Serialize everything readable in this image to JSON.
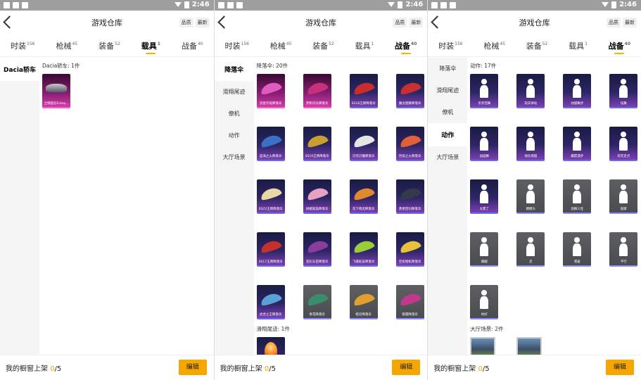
{
  "status": {
    "time": "2:46"
  },
  "header": {
    "title": "游戏仓库",
    "sort_quality": "品质",
    "sort_latest": "最新"
  },
  "tabs": [
    {
      "label": "时装",
      "count": "156"
    },
    {
      "label": "枪械",
      "count": "45"
    },
    {
      "label": "装备",
      "count": "52"
    },
    {
      "label": "载具",
      "count": "1"
    },
    {
      "label": "战备",
      "count": "40"
    }
  ],
  "bottom": {
    "shelf_label": "我的橱窗上架",
    "shelf_current": "0",
    "shelf_total": "/5",
    "edit_label": "编辑"
  },
  "screen1": {
    "active_tab": 3,
    "sidebar": [
      "Dacia轿车"
    ],
    "section_title": "Dacia轿车: 1件",
    "items": [
      {
        "name": "兰博基尼Estoq..."
      }
    ]
  },
  "screen2": {
    "active_tab": 4,
    "sidebar": [
      "降落伞",
      "滑翔尾迹",
      "僚机",
      "动作",
      "大厅场景"
    ],
    "section_title": "降落伞: 20件",
    "items": [
      {
        "name": "流星玲珑降落伞"
      },
      {
        "name": "梦影闪光降落伞"
      },
      {
        "name": "SS18王牌降落伞"
      },
      {
        "name": "魔龙猖獗降落伞"
      },
      {
        "name": "蓝海之火降落伞"
      },
      {
        "name": "SS19王牌降落伞"
      },
      {
        "name": "贝壳贝雕降落伞"
      },
      {
        "name": "烈焰之火降落伞"
      },
      {
        "name": "SS22王牌降落伞"
      },
      {
        "name": "娇媚猫猫降落伞"
      },
      {
        "name": "花下萌虎降落伞"
      },
      {
        "name": "勇者回归降落伞"
      },
      {
        "name": "SS17王牌降落伞"
      },
      {
        "name": "苗彩东苗降落伞"
      },
      {
        "name": "飞碟蛇皮降落伞"
      },
      {
        "name": "空投物机降落伞"
      },
      {
        "name": "虎虎之王降落伞"
      },
      {
        "name": "青花降落伞"
      },
      {
        "name": "橙云降落伞"
      },
      {
        "name": "紫霞降落伞"
      }
    ],
    "section2_title": "滑翔尾迹: 1件"
  },
  "screen3": {
    "active_tab": 4,
    "sidebar": [
      "降落伞",
      "滑翔尾迹",
      "僚机",
      "动作",
      "大厅场景"
    ],
    "section_title": "动作: 17件",
    "items": [
      {
        "name": "亲亲芭舞"
      },
      {
        "name": "欢庆律动"
      },
      {
        "name": "动感舞步"
      },
      {
        "name": "炫舞"
      },
      {
        "name": "加固舞"
      },
      {
        "name": "快乐摇摆"
      },
      {
        "name": "霹雳漫步"
      },
      {
        "name": "欢笑走点"
      },
      {
        "name": "太累了"
      },
      {
        "name": "摸摸头"
      },
      {
        "name": "劲舞三连"
      },
      {
        "name": "鼓掌"
      },
      {
        "name": "踢腿"
      },
      {
        "name": "走"
      },
      {
        "name": "害羞"
      },
      {
        "name": "不行"
      },
      {
        "name": "你好"
      }
    ],
    "section2_title": "大厅场景: 2件"
  }
}
